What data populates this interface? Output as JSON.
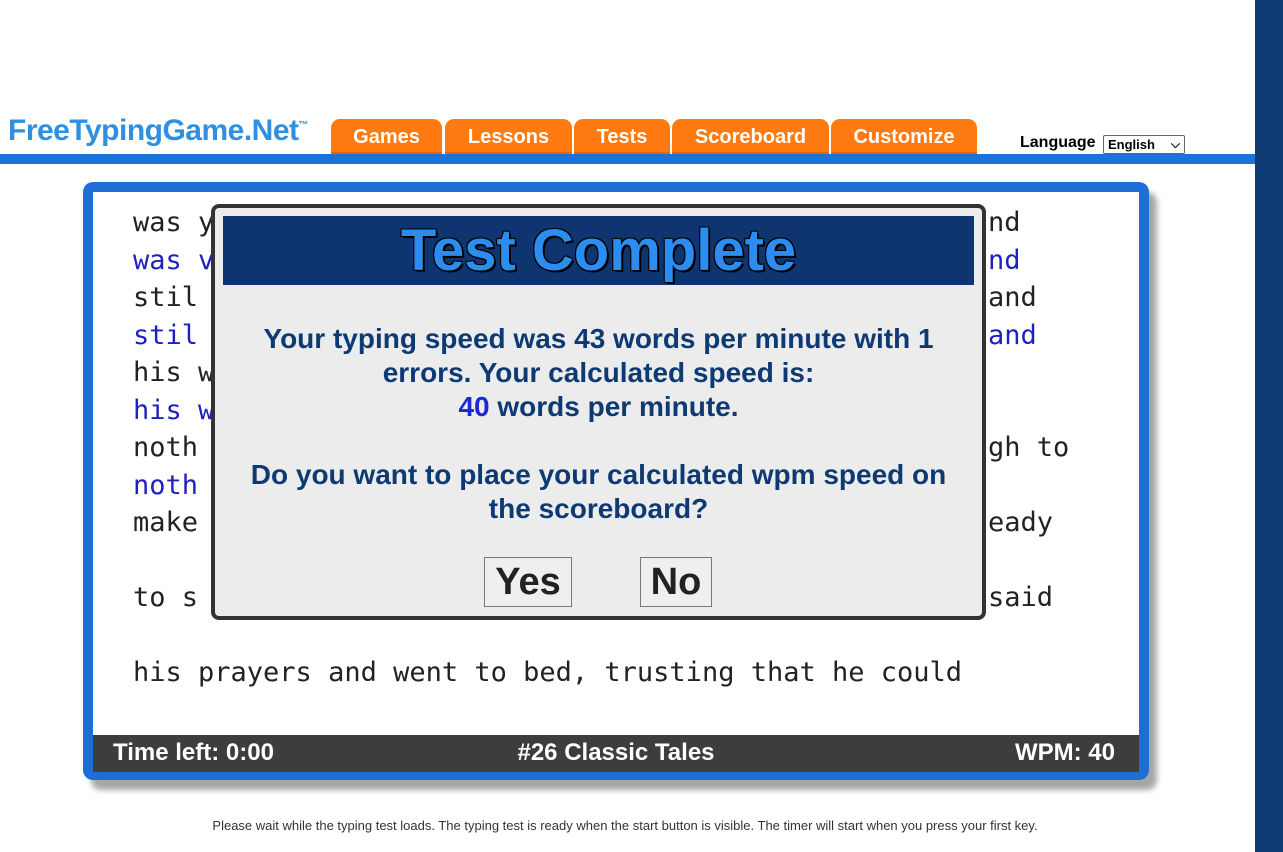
{
  "header": {
    "logo_text": "FreeTypingGame.Net",
    "logo_tm": "™",
    "tabs": [
      {
        "label": "Games"
      },
      {
        "label": "Lessons"
      },
      {
        "label": "Tests"
      },
      {
        "label": "Scoreboard"
      },
      {
        "label": "Customize"
      }
    ],
    "language_label": "Language",
    "language_selected": "English"
  },
  "typing_text": {
    "lines": [
      {
        "text": "was y",
        "right": "nd",
        "typed": false
      },
      {
        "text": "was v",
        "right": "nd",
        "typed": true
      },
      {
        "text": "stil",
        "right": "and",
        "typed": false
      },
      {
        "text": "stil",
        "right": "and",
        "typed": true
      },
      {
        "text": "his w",
        "right": "",
        "typed": false
      },
      {
        "text": "his w",
        "right": "",
        "typed": true
      },
      {
        "text": "noth",
        "right": "gh to",
        "typed": false
      },
      {
        "text": "noth",
        "right": "",
        "typed": true
      },
      {
        "text": "make",
        "right": "eady",
        "typed": false
      },
      {
        "text": "to s",
        "right": "said",
        "typed": false
      },
      {
        "text": "his prayers and went to bed, trusting that he could",
        "right": "",
        "typed": false
      }
    ]
  },
  "status_bar": {
    "time_left": "Time left: 0:00",
    "test_name": "#26 Classic Tales",
    "wpm": "WPM: 40"
  },
  "modal": {
    "title": "Test Complete",
    "message_line1": "Your typing speed was 43 words per minute with 1",
    "message_line2": "errors. Your calculated speed is:",
    "calculated_wpm": "40",
    "wpm_suffix": " words per minute.",
    "question_line1": "Do you want to place your calculated wpm speed on",
    "question_line2": "the scoreboard?",
    "yes_label": "Yes",
    "no_label": "No"
  },
  "footer": {
    "note": "Please wait while the typing test loads. The typing test is ready when the start button is visible. The timer will start when you press your first key."
  },
  "colors": {
    "accent_blue": "#1d6fd6",
    "tab_orange": "#ff7a10",
    "modal_title_bg": "#0f3570",
    "typed_text": "#2020c0"
  }
}
